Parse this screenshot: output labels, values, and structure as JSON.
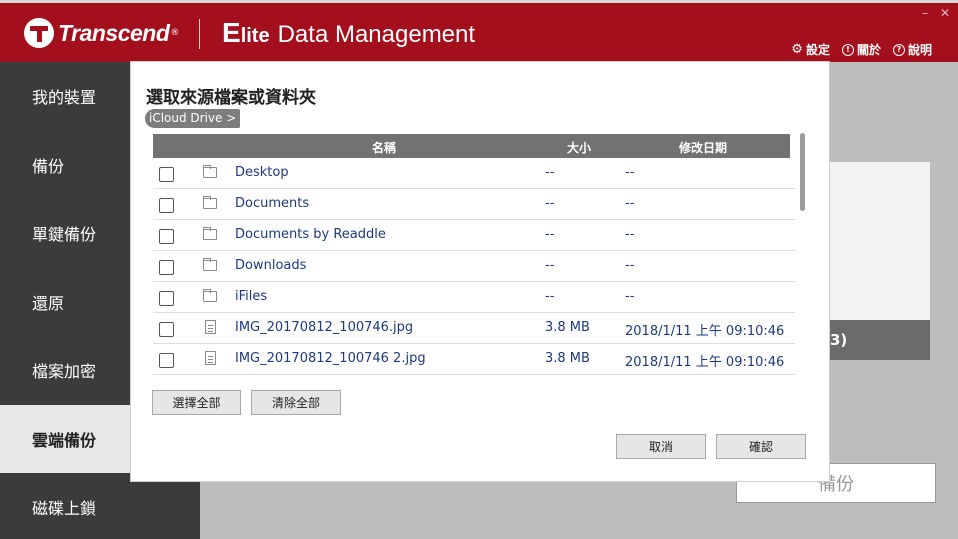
{
  "header": {
    "brand": "Transcend",
    "brand_mark": "®",
    "product_e": "E",
    "product_lite": "lite",
    "product_name": "Data Management",
    "window_controls": [
      "–",
      "✕"
    ],
    "links": [
      {
        "icon": "gear-icon",
        "label": "設定"
      },
      {
        "icon": "info-icon",
        "label": "關於"
      },
      {
        "icon": "help-icon",
        "label": "說明"
      }
    ]
  },
  "sidebar": {
    "items": [
      {
        "label": "我的裝置"
      },
      {
        "label": "備份"
      },
      {
        "label": "單鍵備份"
      },
      {
        "label": "還原"
      },
      {
        "label": "檔案加密"
      },
      {
        "label": "雲端備份",
        "active": true
      },
      {
        "label": "磁碟上鎖"
      }
    ]
  },
  "background": {
    "bar_text": "3)",
    "backup_button": "備份"
  },
  "dialog": {
    "title": "選取來源檔案或資料夾",
    "breadcrumb": "iCloud Drive >",
    "columns": {
      "name": "名稱",
      "size": "大小",
      "modified": "修改日期"
    },
    "rows": [
      {
        "type": "folder",
        "name": "Desktop",
        "size": "--",
        "date": "--"
      },
      {
        "type": "folder",
        "name": "Documents",
        "size": "--",
        "date": "--"
      },
      {
        "type": "folder",
        "name": "Documents by Readdle",
        "size": "--",
        "date": "--"
      },
      {
        "type": "folder",
        "name": "Downloads",
        "size": "--",
        "date": "--"
      },
      {
        "type": "folder",
        "name": "iFiles",
        "size": "--",
        "date": "--"
      },
      {
        "type": "file",
        "name": "IMG_20170812_100746.jpg",
        "size": "3.8 MB",
        "date": "2018/1/11 上午 09:10:46"
      },
      {
        "type": "file",
        "name": "IMG_20170812_100746 2.jpg",
        "size": "3.8 MB",
        "date": "2018/1/11 上午 09:10:46"
      }
    ],
    "select_all": "選擇全部",
    "clear_all": "清除全部",
    "cancel": "取消",
    "confirm": "確認"
  },
  "colors": {
    "header_red": "#a30f1d",
    "sidebar_dark": "#3b3b3b",
    "table_header": "#727272",
    "link_blue": "#1e3a7a"
  }
}
